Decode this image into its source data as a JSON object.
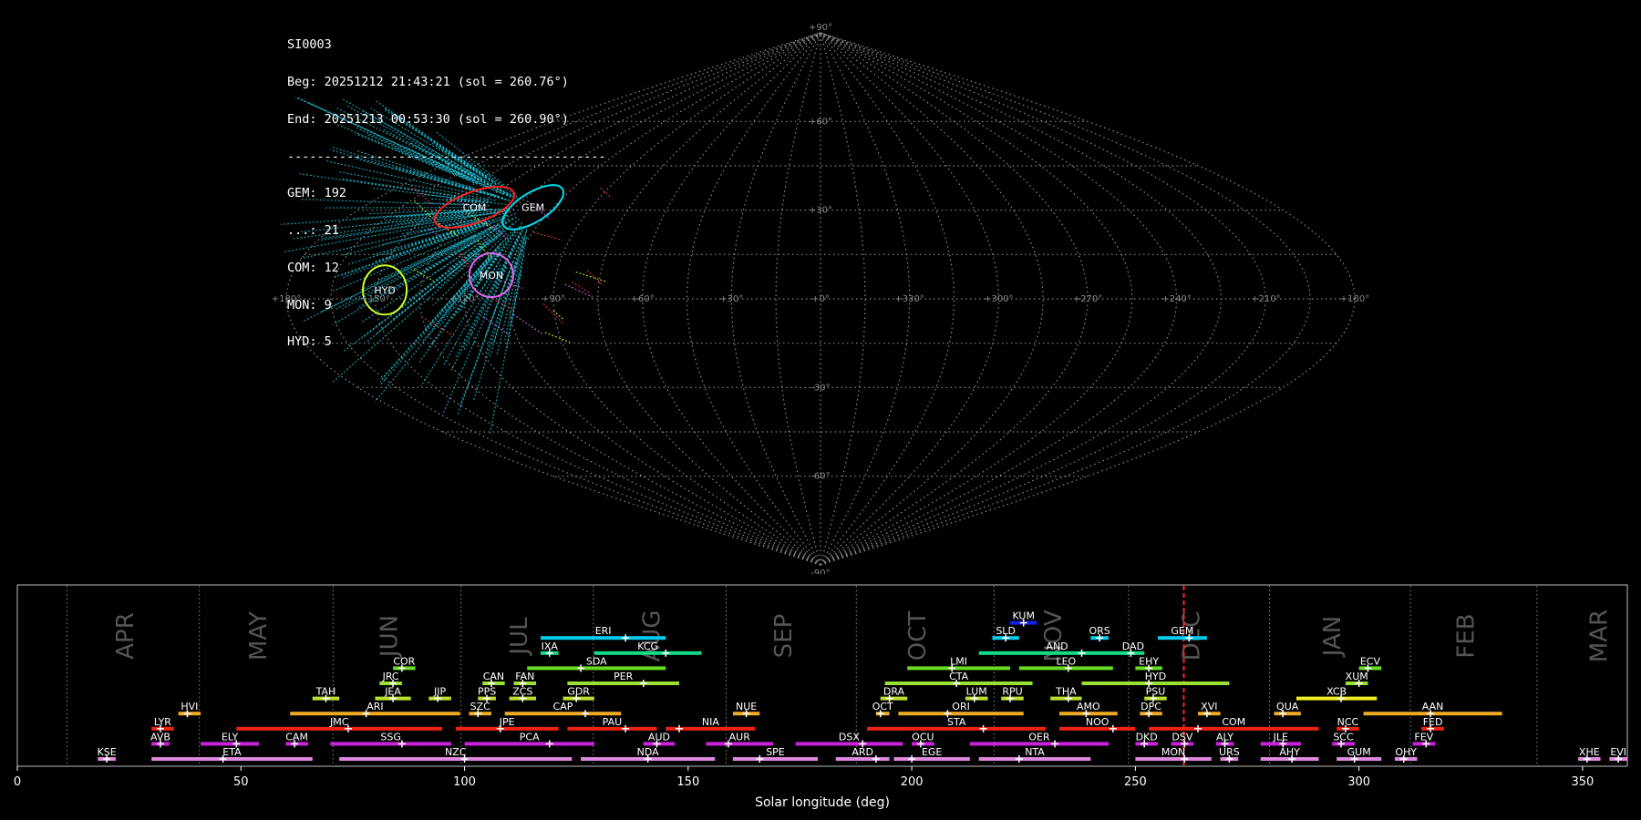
{
  "info": {
    "lines": [
      "SI0003",
      "Beg: 20251212 21:43:21 (sol = 260.76°)",
      "End: 20251213 00:53:30 (sol = 260.90°)",
      "-------------------------------------------",
      "GEM: 192",
      "...: 21",
      "COM: 12",
      "MON: 9",
      "HYD: 5"
    ]
  },
  "skymap": {
    "lon_labels": [
      "+180°",
      "+150°",
      "+120°",
      "+90°",
      "+60°",
      "+30°",
      "+0°",
      "+330°",
      "+300°",
      "+270°",
      "+240°",
      "+210°",
      "+180°"
    ],
    "lat_labels": [
      "+90°",
      "+60°",
      "+30°",
      "-30°",
      "-60°",
      "-90°"
    ],
    "radiants": [
      {
        "code": "COM",
        "color": "#ff2020",
        "lon": 136,
        "lat": 31
      },
      {
        "code": "GEM",
        "color": "#00ddee",
        "lon": 113,
        "lat": 31
      },
      {
        "code": "HYD",
        "color": "#ccff22",
        "lon": 147,
        "lat": 3
      },
      {
        "code": "MON",
        "color": "#dd66ee",
        "lon": 112,
        "lat": 8
      }
    ]
  },
  "chart_data": {
    "type": "timeline",
    "xlabel": "Solar longitude (deg)",
    "xlim": [
      0,
      360
    ],
    "xticks": [
      0,
      50,
      100,
      150,
      200,
      250,
      300,
      350
    ],
    "current_sol": 260.83,
    "months": [
      {
        "name": "APR",
        "start": 11.1
      },
      {
        "name": "MAY",
        "start": 40.7
      },
      {
        "name": "JUN",
        "start": 70.6
      },
      {
        "name": "JUL",
        "start": 99.2
      },
      {
        "name": "AUG",
        "start": 128.8
      },
      {
        "name": "SEP",
        "start": 158.5
      },
      {
        "name": "OCT",
        "start": 187.6
      },
      {
        "name": "NOV",
        "start": 218.4
      },
      {
        "name": "DEC",
        "start": 248.5
      },
      {
        "name": "JAN",
        "start": 280.0
      },
      {
        "name": "FEB",
        "start": 311.5
      },
      {
        "name": "MAR",
        "start": 339.8
      }
    ],
    "showers": [
      {
        "code": "KUM",
        "row": 10,
        "start": 222,
        "end": 228,
        "peak": 225,
        "color": "#1020ee"
      },
      {
        "code": "ERI",
        "row": 9,
        "start": 117,
        "end": 145,
        "peak": 136,
        "color": "#00ccee"
      },
      {
        "code": "SLD",
        "row": 9,
        "start": 218,
        "end": 224,
        "peak": 221,
        "color": "#00ccee"
      },
      {
        "code": "ORS",
        "row": 9,
        "start": 240,
        "end": 244,
        "peak": 242,
        "color": "#00ccee"
      },
      {
        "code": "GEM",
        "row": 9,
        "start": 255,
        "end": 266,
        "peak": 262,
        "color": "#00ccee"
      },
      {
        "code": "IXA",
        "row": 8,
        "start": 117,
        "end": 121,
        "peak": 119,
        "color": "#11dd88"
      },
      {
        "code": "KCG",
        "row": 8,
        "start": 129,
        "end": 153,
        "peak": 145,
        "color": "#11dd88"
      },
      {
        "code": "AND",
        "row": 8,
        "start": 215,
        "end": 250,
        "peak": 238,
        "color": "#11dd88"
      },
      {
        "code": "DAD",
        "row": 8,
        "start": 247,
        "end": 252,
        "peak": 249,
        "color": "#11dd88"
      },
      {
        "code": "COR",
        "row": 7,
        "start": 84,
        "end": 89,
        "peak": 86,
        "color": "#66dd22"
      },
      {
        "code": "SDA",
        "row": 7,
        "start": 114,
        "end": 145,
        "peak": 126,
        "color": "#66dd22"
      },
      {
        "code": "LMI",
        "row": 7,
        "start": 199,
        "end": 222,
        "peak": 209,
        "color": "#66dd22"
      },
      {
        "code": "LEO",
        "row": 7,
        "start": 224,
        "end": 245,
        "peak": 235,
        "color": "#66dd22"
      },
      {
        "code": "EHY",
        "row": 7,
        "start": 250,
        "end": 256,
        "peak": 253,
        "color": "#66dd22"
      },
      {
        "code": "ECV",
        "row": 7,
        "start": 300,
        "end": 305,
        "peak": 302,
        "color": "#66dd22"
      },
      {
        "code": "JRC",
        "row": 6,
        "start": 81,
        "end": 86,
        "peak": 84,
        "color": "#99e033"
      },
      {
        "code": "CAN",
        "row": 6,
        "start": 104,
        "end": 109,
        "peak": 106,
        "color": "#99e033"
      },
      {
        "code": "FAN",
        "row": 6,
        "start": 111,
        "end": 116,
        "peak": 113,
        "color": "#99e033"
      },
      {
        "code": "PER",
        "row": 6,
        "start": 123,
        "end": 148,
        "peak": 140,
        "color": "#99e033"
      },
      {
        "code": "CTA",
        "row": 6,
        "start": 194,
        "end": 227,
        "peak": 210,
        "color": "#99e033"
      },
      {
        "code": "HYD",
        "row": 6,
        "start": 238,
        "end": 271,
        "peak": 253,
        "color": "#99e033"
      },
      {
        "code": "XUM",
        "row": 6,
        "start": 297,
        "end": 302,
        "peak": 300,
        "color": "#99e033"
      },
      {
        "code": "TAH",
        "row": 5,
        "start": 66,
        "end": 72,
        "peak": 69,
        "color": "#bbe033"
      },
      {
        "code": "JEA",
        "row": 5,
        "start": 80,
        "end": 88,
        "peak": 84,
        "color": "#bbe033"
      },
      {
        "code": "JIP",
        "row": 5,
        "start": 92,
        "end": 97,
        "peak": 94,
        "color": "#bbe033"
      },
      {
        "code": "PPS",
        "row": 5,
        "start": 103,
        "end": 107,
        "peak": 105,
        "color": "#bbe033"
      },
      {
        "code": "ZCS",
        "row": 5,
        "start": 110,
        "end": 116,
        "peak": 113,
        "color": "#bbe033"
      },
      {
        "code": "GDR",
        "row": 5,
        "start": 122,
        "end": 129,
        "peak": 125,
        "color": "#bbe033"
      },
      {
        "code": "DRA",
        "row": 5,
        "start": 193,
        "end": 199,
        "peak": 195,
        "color": "#bbe033"
      },
      {
        "code": "LUM",
        "row": 5,
        "start": 212,
        "end": 217,
        "peak": 214,
        "color": "#bbe033"
      },
      {
        "code": "RPU",
        "row": 5,
        "start": 220,
        "end": 225,
        "peak": 222,
        "color": "#bbe033"
      },
      {
        "code": "THA",
        "row": 5,
        "start": 231,
        "end": 238,
        "peak": 235,
        "color": "#bbe033"
      },
      {
        "code": "PSU",
        "row": 5,
        "start": 252,
        "end": 257,
        "peak": 254,
        "color": "#bbe033"
      },
      {
        "code": "XCB",
        "row": 5,
        "start": 286,
        "end": 304,
        "peak": 296,
        "color": "#eeee22"
      },
      {
        "code": "HVI",
        "row": 4,
        "start": 36,
        "end": 41,
        "peak": 38,
        "color": "#eeaa22"
      },
      {
        "code": "ARI",
        "row": 4,
        "start": 61,
        "end": 99,
        "peak": 78,
        "color": "#eeaa22"
      },
      {
        "code": "SZC",
        "row": 4,
        "start": 101,
        "end": 106,
        "peak": 103,
        "color": "#eeaa22"
      },
      {
        "code": "CAP",
        "row": 4,
        "start": 109,
        "end": 135,
        "peak": 127,
        "color": "#eeaa22"
      },
      {
        "code": "NUE",
        "row": 4,
        "start": 160,
        "end": 166,
        "peak": 163,
        "color": "#eeaa22"
      },
      {
        "code": "OCT",
        "row": 4,
        "start": 192,
        "end": 195,
        "peak": 193,
        "color": "#eeaa22"
      },
      {
        "code": "ORI",
        "row": 4,
        "start": 197,
        "end": 225,
        "peak": 208,
        "color": "#eeaa22"
      },
      {
        "code": "AMO",
        "row": 4,
        "start": 233,
        "end": 246,
        "peak": 239,
        "color": "#eeaa22"
      },
      {
        "code": "DPC",
        "row": 4,
        "start": 251,
        "end": 256,
        "peak": 253,
        "color": "#eeaa22"
      },
      {
        "code": "XVI",
        "row": 4,
        "start": 264,
        "end": 269,
        "peak": 266,
        "color": "#eeaa22"
      },
      {
        "code": "QUA",
        "row": 4,
        "start": 281,
        "end": 287,
        "peak": 283,
        "color": "#eeaa22"
      },
      {
        "code": "AAN",
        "row": 4,
        "start": 301,
        "end": 332,
        "peak": 316,
        "color": "#eeaa22"
      },
      {
        "code": "LYR",
        "row": 3,
        "start": 30,
        "end": 35,
        "peak": 32,
        "color": "#ee2211"
      },
      {
        "code": "JMC",
        "row": 3,
        "start": 49,
        "end": 95,
        "peak": 74,
        "color": "#ee2211"
      },
      {
        "code": "JPE",
        "row": 3,
        "start": 98,
        "end": 121,
        "peak": 108,
        "color": "#ee2211"
      },
      {
        "code": "PAU",
        "row": 3,
        "start": 123,
        "end": 143,
        "peak": 136,
        "color": "#ee2211"
      },
      {
        "code": "NIA",
        "row": 3,
        "start": 145,
        "end": 165,
        "peak": 148,
        "color": "#ee2211"
      },
      {
        "code": "STA",
        "row": 3,
        "start": 190,
        "end": 230,
        "peak": 216,
        "color": "#ee2211"
      },
      {
        "code": "NOO",
        "row": 3,
        "start": 233,
        "end": 250,
        "peak": 245,
        "color": "#ee2211"
      },
      {
        "code": "COM",
        "row": 3,
        "start": 253,
        "end": 291,
        "peak": 264,
        "color": "#ee2211"
      },
      {
        "code": "NCC",
        "row": 3,
        "start": 295,
        "end": 300,
        "peak": 297,
        "color": "#ee2211"
      },
      {
        "code": "FED",
        "row": 3,
        "start": 314,
        "end": 319,
        "peak": 316,
        "color": "#ee2211"
      },
      {
        "code": "AVB",
        "row": 2,
        "start": 30,
        "end": 34,
        "peak": 32,
        "color": "#cc22dd"
      },
      {
        "code": "ELY",
        "row": 2,
        "start": 41,
        "end": 54,
        "peak": 49,
        "color": "#cc22dd"
      },
      {
        "code": "CAM",
        "row": 2,
        "start": 60,
        "end": 65,
        "peak": 62,
        "color": "#cc22dd"
      },
      {
        "code": "SSG",
        "row": 2,
        "start": 70,
        "end": 97,
        "peak": 86,
        "color": "#cc22dd"
      },
      {
        "code": "PCA",
        "row": 2,
        "start": 100,
        "end": 129,
        "peak": 119,
        "color": "#cc22dd"
      },
      {
        "code": "AUD",
        "row": 2,
        "start": 140,
        "end": 147,
        "peak": 143,
        "color": "#cc22dd"
      },
      {
        "code": "AUR",
        "row": 2,
        "start": 154,
        "end": 169,
        "peak": 159,
        "color": "#cc22dd"
      },
      {
        "code": "DSX",
        "row": 2,
        "start": 174,
        "end": 198,
        "peak": 189,
        "color": "#cc22dd"
      },
      {
        "code": "OCU",
        "row": 2,
        "start": 200,
        "end": 205,
        "peak": 202,
        "color": "#cc22dd"
      },
      {
        "code": "OER",
        "row": 2,
        "start": 213,
        "end": 244,
        "peak": 232,
        "color": "#cc22dd"
      },
      {
        "code": "DKD",
        "row": 2,
        "start": 250,
        "end": 255,
        "peak": 252,
        "color": "#cc22dd"
      },
      {
        "code": "DSV",
        "row": 2,
        "start": 258,
        "end": 263,
        "peak": 261,
        "color": "#cc22dd"
      },
      {
        "code": "ALY",
        "row": 2,
        "start": 268,
        "end": 272,
        "peak": 270,
        "color": "#cc22dd"
      },
      {
        "code": "JLE",
        "row": 2,
        "start": 278,
        "end": 287,
        "peak": 283,
        "color": "#cc22dd"
      },
      {
        "code": "SCC",
        "row": 2,
        "start": 294,
        "end": 299,
        "peak": 296,
        "color": "#cc22dd"
      },
      {
        "code": "FEV",
        "row": 2,
        "start": 312,
        "end": 317,
        "peak": 315,
        "color": "#cc22dd"
      },
      {
        "code": "KSE",
        "row": 1,
        "start": 18,
        "end": 22,
        "peak": 20,
        "color": "#dd88dd"
      },
      {
        "code": "ETA",
        "row": 1,
        "start": 30,
        "end": 66,
        "peak": 46,
        "color": "#dd88dd"
      },
      {
        "code": "NZC",
        "row": 1,
        "start": 72,
        "end": 124,
        "peak": 100,
        "color": "#dd88dd"
      },
      {
        "code": "NDA",
        "row": 1,
        "start": 126,
        "end": 156,
        "peak": 141,
        "color": "#dd88dd"
      },
      {
        "code": "SPE",
        "row": 1,
        "start": 160,
        "end": 179,
        "peak": 166,
        "color": "#dd88dd"
      },
      {
        "code": "ARD",
        "row": 1,
        "start": 183,
        "end": 195,
        "peak": 192,
        "color": "#dd88dd"
      },
      {
        "code": "EGE",
        "row": 1,
        "start": 196,
        "end": 213,
        "peak": 200,
        "color": "#dd88dd"
      },
      {
        "code": "NTA",
        "row": 1,
        "start": 215,
        "end": 240,
        "peak": 224,
        "color": "#dd88dd"
      },
      {
        "code": "MON",
        "row": 1,
        "start": 250,
        "end": 267,
        "peak": 261,
        "color": "#dd88dd"
      },
      {
        "code": "URS",
        "row": 1,
        "start": 269,
        "end": 273,
        "peak": 271,
        "color": "#dd88dd"
      },
      {
        "code": "AHY",
        "row": 1,
        "start": 278,
        "end": 291,
        "peak": 285,
        "color": "#dd88dd"
      },
      {
        "code": "GUM",
        "row": 1,
        "start": 295,
        "end": 305,
        "peak": 299,
        "color": "#dd88dd"
      },
      {
        "code": "OHY",
        "row": 1,
        "start": 308,
        "end": 313,
        "peak": 310,
        "color": "#dd88dd"
      },
      {
        "code": "XHE",
        "row": 1,
        "start": 349,
        "end": 354,
        "peak": 351,
        "color": "#dd88dd"
      },
      {
        "code": "EVI",
        "row": 1,
        "start": 356,
        "end": 360,
        "peak": 358,
        "color": "#dd88dd"
      }
    ]
  }
}
